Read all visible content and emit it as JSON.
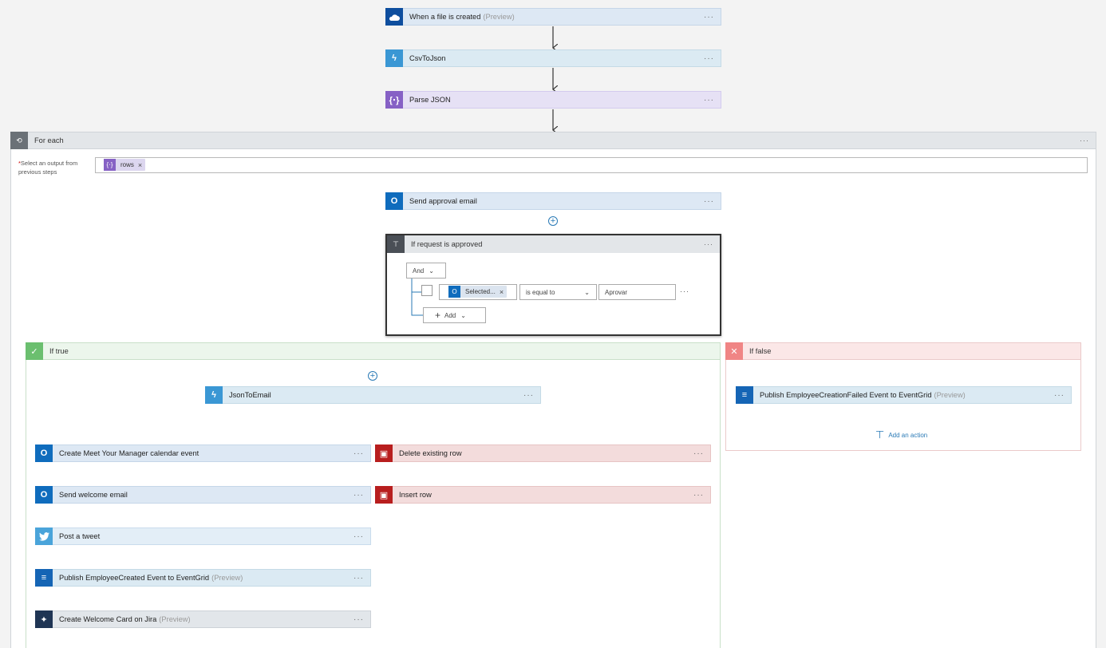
{
  "trigger": {
    "label": "When a file is created",
    "preview": "(Preview)",
    "icon": "onedrive-icon"
  },
  "csv_to_json": {
    "label": "CsvToJson",
    "icon": "function-icon"
  },
  "parse_json": {
    "label": "Parse JSON",
    "icon": "parse-json-icon"
  },
  "for_each": {
    "title": "For each",
    "field_label": "Select an output from previous steps",
    "required_mark": "*",
    "token": "rows"
  },
  "send_approval": {
    "label": "Send approval email"
  },
  "condition": {
    "title": "If request is approved",
    "and_label": "And",
    "token_label": "Selected...",
    "operator": "is equal to",
    "value": "Aprovar",
    "add_label": "Add"
  },
  "if_true": {
    "title": "If true",
    "json_to_email": "JsonToEmail",
    "calendar": "Create Meet Your Manager calendar event",
    "welcome_email": "Send welcome email",
    "tweet": "Post a tweet",
    "publish_created": "Publish EmployeeCreated Event to EventGrid",
    "publish_created_preview": "(Preview)",
    "jira": "Create Welcome Card on Jira",
    "jira_preview": "(Preview)",
    "delete_row": "Delete existing row",
    "insert_row": "Insert row"
  },
  "if_false": {
    "title": "If false",
    "publish_failed": "Publish EmployeeCreationFailed Event to EventGrid",
    "publish_failed_preview": "(Preview)",
    "add_action": "Add an action"
  },
  "more_glyph": "···",
  "colors": {
    "outlook": "#0f6cbd",
    "sql": "#b81e1e",
    "true_green": "#5fb865",
    "false_red": "#f08585",
    "link_blue": "#2a7ab6"
  }
}
